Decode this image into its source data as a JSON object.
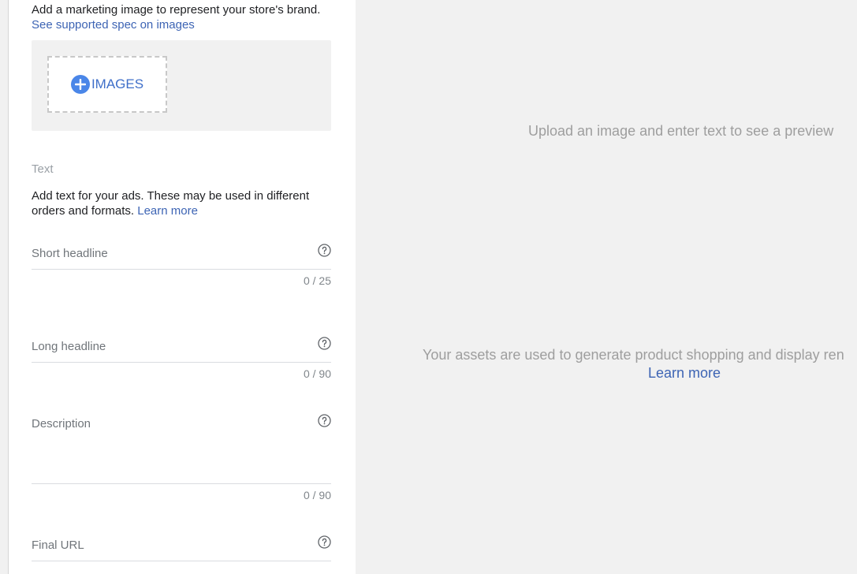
{
  "image_section": {
    "description": "Add a marketing image to represent your store's brand.",
    "spec_link": "See supported spec on images",
    "add_button_label": "IMAGES"
  },
  "text_section": {
    "heading": "Text",
    "description": "Add text for your ads. These may be used in different orders and formats.",
    "learn_more": "Learn more"
  },
  "fields": {
    "short_headline": {
      "label": "Short headline",
      "counter": "0 / 25"
    },
    "long_headline": {
      "label": "Long headline",
      "counter": "0 / 90"
    },
    "description": {
      "label": "Description",
      "counter": "0 / 90"
    },
    "final_url": {
      "label": "Final URL"
    }
  },
  "preview": {
    "empty_message": "Upload an image and enter text to see a preview",
    "assets_message": "Your assets are used to generate product shopping and display ren",
    "learn_more": "Learn more"
  },
  "icons": {
    "add": "plus-circle-icon",
    "help": "help-circle-icon"
  },
  "colors": {
    "link": "#3d64b4",
    "accent": "#4a86e8",
    "preview_bg": "#f1f1f1"
  }
}
